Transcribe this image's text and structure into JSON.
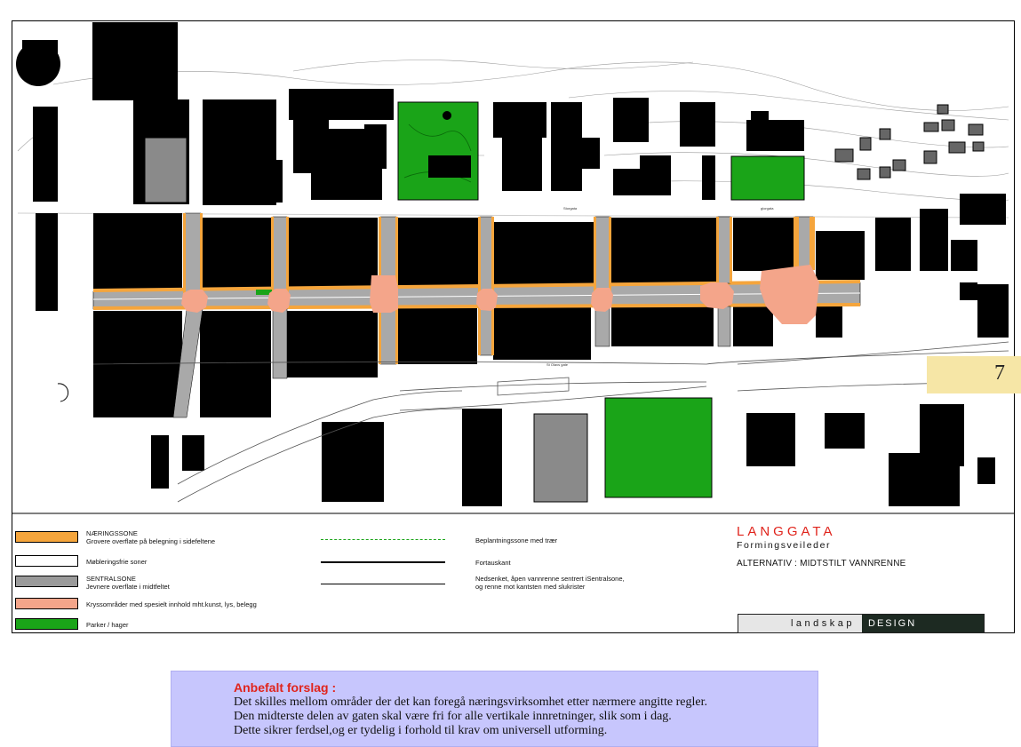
{
  "map": {
    "street_labels": [
      "Storgata",
      "glorgata",
      "St Olavs gate"
    ]
  },
  "page_number": "7",
  "legend": {
    "items": [
      {
        "title": "NÆRINGSSONE",
        "text": "Grovere overflate på belegning i sidefeltene",
        "color": "#f5a53c"
      },
      {
        "title": "",
        "text": "Møbleringsfrie soner",
        "color": "#ffffff"
      },
      {
        "title": "SENTRALSONE",
        "text": "Jevnere overflate i midtfeltet",
        "color": "#9a9a9a"
      },
      {
        "title": "",
        "text": "Kryssområder med spesielt innhold  mht.kunst, lys, belegg",
        "color": "#f4a58a"
      },
      {
        "title": "",
        "text": "Parker / hager",
        "color": "#1aa418"
      }
    ],
    "lines": [
      {
        "text": "Beplantningssone med trær",
        "style": "green-dashed"
      },
      {
        "text": "Fortauskant",
        "style": "thick-solid"
      },
      {
        "text": "Nedsenket, åpen vannrenne sentrert iSentralsone,",
        "text2": " og renne mot kantsten med slukrister",
        "style": "thin-solid"
      }
    ]
  },
  "title_block": {
    "title": "LANGGATA",
    "subtitle": "Formingsveileder",
    "alternative": "ALTERNATIV : MIDTSTILT  VANNRENNE"
  },
  "brand": {
    "left": "landskap",
    "right": "DESIGN"
  },
  "proposal": {
    "title": "Anbefalt forslag :",
    "lines": [
      "Det skilles mellom områder der det kan foregå næringsvirksomhet etter nærmere angitte regler.",
      "Den midterste delen av gaten skal være fri for alle vertikale innretninger, slik som i dag.",
      "Dette sikrer ferdsel,og er tydelig i forhold til krav om universell utforming."
    ]
  },
  "colors": {
    "buildings": "#000000",
    "street_gray": "#a9a9a9",
    "commerce_orange": "#f5a53c",
    "crossing_salmon": "#f4a58a",
    "park_green": "#1aa418",
    "title_red": "#e0241c",
    "proposal_bg": "#c7c6fd"
  }
}
